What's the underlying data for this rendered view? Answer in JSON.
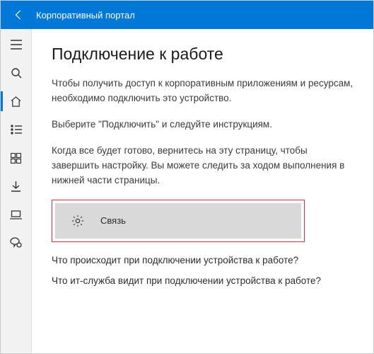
{
  "header": {
    "title": "Корпоративный портал"
  },
  "sidebar": {
    "items": [
      {
        "name": "menu",
        "icon": "menu-icon"
      },
      {
        "name": "search",
        "icon": "search-icon"
      },
      {
        "name": "home",
        "icon": "home-icon",
        "active": true
      },
      {
        "name": "apps",
        "icon": "list-icon"
      },
      {
        "name": "tiles",
        "icon": "tiles-icon"
      },
      {
        "name": "download",
        "icon": "download-icon"
      },
      {
        "name": "device",
        "icon": "laptop-icon"
      },
      {
        "name": "support",
        "icon": "support-icon"
      }
    ]
  },
  "main": {
    "heading": "Подключение к работе",
    "para1": "Чтобы получить доступ к корпоративным приложениям и ресурсам, необходимо подключить это устройство.",
    "para2": "Выберите \"Подключить\" и следуйте инструкциям.",
    "para3": "Когда все будет готово, вернитесь на эту страницу, чтобы завершить настройку. Вы можете следить за ходом выполнения в нижней части страницы.",
    "connect_label": "Связь",
    "faq1": "Что происходит при подключении устройства к работе?",
    "faq2": "Что ит-служба видит при подключении устройства к работе?"
  },
  "colors": {
    "accent": "#0078d7",
    "highlight_border": "#e03040"
  }
}
